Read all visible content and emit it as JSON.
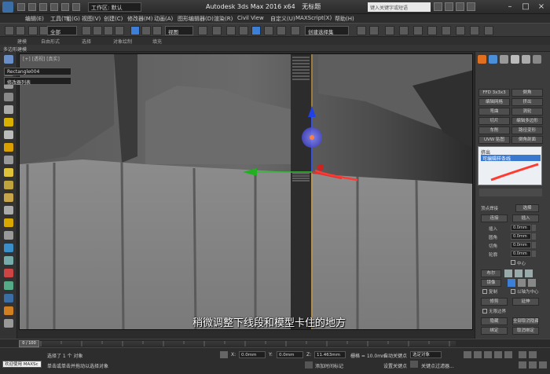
{
  "titlebar": {
    "workspace": "工作区: 默认",
    "app_title": "Autodesk 3ds Max 2016 x64",
    "file_title": "无标题",
    "search_placeholder": "键入关键字或短语"
  },
  "menu": [
    "编辑(E)",
    "工具(T)",
    "组(G)",
    "视图(V)",
    "创建(C)",
    "修改器(M)",
    "动画(A)",
    "图形编辑器(D)",
    "渲染(R)",
    "Civil View",
    "自定义(U)",
    "MAXScript(X)",
    "帮助(H)"
  ],
  "toolbar": {
    "selection_filter": "全部",
    "ref_coord": "视图",
    "selection_set": "创建选择集"
  },
  "ribbon": {
    "tabs": [
      "建模",
      "自由形式",
      "选择",
      "对象绘制",
      "填充"
    ],
    "sub_label": "多边形建模"
  },
  "viewport": {
    "label": "[+] [透视] [真实]",
    "caption": "稍微调整下线段和模型卡住的地方"
  },
  "command_panel": {
    "object_name": "Rectangle004",
    "modifier_list": "修改器列表",
    "modifier_buttons": [
      "FFD 3x3x3",
      "倒角",
      "编辑网格",
      "挤出",
      "弯曲",
      "涡轮",
      "切片",
      "编辑多边形",
      "车削",
      "路径变形",
      "UVW 贴图",
      "倒角剖面"
    ],
    "stack": [
      "挤出",
      "可编辑样条线"
    ],
    "section_select": "选择",
    "vertex_label": "顶点焊接",
    "attach": "附加",
    "buttons": [
      "连接",
      "插入"
    ],
    "fields": [
      {
        "label": "插入",
        "value": "0.0mm"
      },
      {
        "label": "圆角",
        "value": "0.0mm"
      },
      {
        "label": "切角",
        "value": "0.0mm"
      },
      {
        "label": "轮廓",
        "value": "0.0mm"
      }
    ],
    "center_label": "中心",
    "boolean_label": "布尔",
    "mirror_label": "镜像",
    "copy_label": "复制",
    "about_pivot": "以轴为中心",
    "trim": "修剪",
    "extend": "延伸",
    "infinite_bounds": "无限边界",
    "hide": "隐藏",
    "unhide_all": "全部取消隐藏",
    "bind": "绑定",
    "unbind": "取消绑定",
    "delete": "删除",
    "close": "关闭",
    "split": "拆分",
    "detach": "分离",
    "explode": "炸开"
  },
  "timeline": {
    "frame_display": "0 / 100",
    "ticks": [
      "0",
      "5",
      "10",
      "15",
      "20",
      "25",
      "30",
      "35",
      "40",
      "45",
      "50",
      "55",
      "60",
      "65",
      "70",
      "75",
      "80",
      "85",
      "90",
      "95",
      "100"
    ]
  },
  "status": {
    "welcome": "欢迎使用 MAXSc",
    "selected": "选择了 1 个 对象",
    "hint": "单击或单击并拖动以选择对象",
    "x_label": "X:",
    "x": "0.0mm",
    "y_label": "Y:",
    "y": "0.0mm",
    "z_label": "Z:",
    "z": "11.463mm",
    "grid": "栅格 = 10.0mm",
    "autokey": "自动关键点",
    "setkey": "设置关键点",
    "selected_obj": "选定对象",
    "add_time_tag": "添加时间标记",
    "key_filter": "关键点过滤器..."
  }
}
